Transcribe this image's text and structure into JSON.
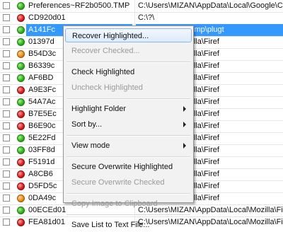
{
  "rows": [
    {
      "name": "Preferences~RF2b0500.TMP",
      "path": "C:\\Users\\MIZAN\\AppData\\Local\\Google\\Chro",
      "status": "green"
    },
    {
      "name": "CD920d01",
      "path": "C:\\?\\",
      "status": "red"
    },
    {
      "name": "A141Fc",
      "path": "ppData\\Local\\Temp\\plugt",
      "status": "green",
      "selected": true
    },
    {
      "name": "01397d",
      "path": "Data\\Local\\Mozilla\\Firef",
      "status": "green"
    },
    {
      "name": "B54D3c",
      "path": "Data\\Local\\Mozilla\\Firef",
      "status": "orange"
    },
    {
      "name": "B6339c",
      "path": "Data\\Local\\Mozilla\\Firef",
      "status": "green"
    },
    {
      "name": "AF6BD",
      "path": "Data\\Local\\Mozilla\\Firef",
      "status": "green"
    },
    {
      "name": "A9E3Fc",
      "path": "Data\\Local\\Mozilla\\Firef",
      "status": "red"
    },
    {
      "name": "54A7Ac",
      "path": "Data\\Local\\Mozilla\\Firef",
      "status": "green"
    },
    {
      "name": "B7E5Ec",
      "path": "Data\\Local\\Mozilla\\Firef",
      "status": "red"
    },
    {
      "name": "B6E90c",
      "path": "Data\\Local\\Mozilla\\Firef",
      "status": "red"
    },
    {
      "name": "5E22Fd",
      "path": "Data\\Local\\Mozilla\\Firef",
      "status": "green"
    },
    {
      "name": "03FF8d",
      "path": "Data\\Local\\Mozilla\\Firef",
      "status": "green"
    },
    {
      "name": "F5191d",
      "path": "Data\\Local\\Mozilla\\Firef",
      "status": "red"
    },
    {
      "name": "A8CB6",
      "path": "Data\\Local\\Mozilla\\Firef",
      "status": "red"
    },
    {
      "name": "D5FD5c",
      "path": "Data\\Local\\Mozilla\\Firef",
      "status": "red"
    },
    {
      "name": "0DA49c",
      "path": "Data\\Local\\Mozilla\\Firef",
      "status": "orange"
    },
    {
      "name": "00ECEd01",
      "path": "C:\\Users\\MIZAN\\AppData\\Local\\Mozilla\\Firef",
      "status": "green"
    },
    {
      "name": "FEA81d01",
      "path": "C:\\Users\\MIZAN\\AppData\\Local\\Mozilla\\Firef",
      "status": "red"
    }
  ],
  "menu": {
    "items": [
      {
        "label": "Recover Highlighted...",
        "disabled": false,
        "hover": true,
        "submenu": false
      },
      {
        "label": "Recover Checked...",
        "disabled": true,
        "submenu": false
      },
      {
        "separator": true
      },
      {
        "label": "Check Highlighted",
        "disabled": false,
        "submenu": false
      },
      {
        "label": "Uncheck Highlighted",
        "disabled": true,
        "submenu": false
      },
      {
        "separator": true
      },
      {
        "label": "Highlight Folder",
        "disabled": false,
        "submenu": true
      },
      {
        "label": "Sort by...",
        "disabled": false,
        "submenu": true
      },
      {
        "separator": true
      },
      {
        "label": "View mode",
        "disabled": false,
        "submenu": true
      },
      {
        "separator": true
      },
      {
        "label": "Secure Overwrite Highlighted",
        "disabled": false,
        "submenu": false
      },
      {
        "label": "Secure Overwrite Checked",
        "disabled": true,
        "submenu": false
      },
      {
        "separator": true
      },
      {
        "label": "Copy Image to Clipboard",
        "disabled": true,
        "submenu": false
      },
      {
        "separator": true
      },
      {
        "label": "Save List to Text File...",
        "disabled": false,
        "submenu": false
      }
    ]
  },
  "colors": {
    "selection": "#3399ff",
    "status_green": "#31b51a",
    "status_red": "#e02020",
    "status_orange": "#f08d14"
  }
}
